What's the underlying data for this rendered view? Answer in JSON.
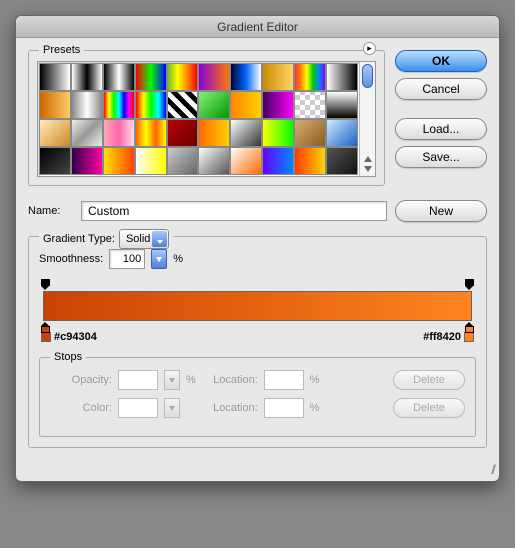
{
  "title": "Gradient Editor",
  "buttons": {
    "ok": "OK",
    "cancel": "Cancel",
    "load": "Load...",
    "save": "Save...",
    "new": "New",
    "delete": "Delete"
  },
  "presets": {
    "legend": "Presets",
    "swatches": [
      "linear-gradient(90deg,#000,#fff)",
      "linear-gradient(90deg,#fff,#000,#fff)",
      "linear-gradient(90deg,#000,#fff,#000)",
      "linear-gradient(90deg,#ff0000,#00ff00,#0000ff)",
      "linear-gradient(90deg,#7b2,#ff0,#f80,#f00)",
      "linear-gradient(90deg,#8800dd,#ff7700)",
      "linear-gradient(90deg,#003,#06f,#fff)",
      "linear-gradient(90deg,#c80,#ffd566)",
      "linear-gradient(90deg,#f33,#f80,#ff0,#0c0,#08f,#80f)",
      "linear-gradient(90deg,rgba(0,0,0,0),#000)",
      "linear-gradient(90deg,#cc6600,#ffcc66)",
      "linear-gradient(90deg,#888,#fff,#888)",
      "linear-gradient(90deg,#f00,#ff0,#0f0,#0ff,#00f,#f0f,#f00)",
      "linear-gradient(90deg,#f00,#ff0,#0f0,#0ff,#00f)",
      "repeating-linear-gradient(45deg,#000 0 5px,#fff 5px 10px)",
      "linear-gradient(135deg,#8e7,#090)",
      "linear-gradient(90deg,#ff8400,#ffd000)",
      "linear-gradient(90deg,#400060,#ff00ff)",
      "repeating-conic-gradient(#ccc 0 25%,#fff 0 50%) 0/10px 10px",
      "linear-gradient(180deg,#fff,#000)",
      "linear-gradient(135deg,#ffeec0,#cc8822)",
      "linear-gradient(135deg,#eee,#999,#eee)",
      "linear-gradient(90deg,#fab,#f6a,#fde)",
      "linear-gradient(90deg,#f60,#ff0,#f60,#ff0)",
      "linear-gradient(135deg,#b00,#600)",
      "linear-gradient(90deg,#ff6a00,#ffd000)",
      "linear-gradient(135deg,#fff,#333)",
      "linear-gradient(90deg,#ff0,#0f0)",
      "linear-gradient(135deg,#d8b070,#8a5a20)",
      "linear-gradient(135deg,#cfeaff,#1a62c8)",
      "linear-gradient(135deg,#000,#444)",
      "linear-gradient(90deg,#330044,#ff00aa)",
      "linear-gradient(90deg,#ffe000,#ff4400)",
      "linear-gradient(90deg,#fff,#ff0)",
      "linear-gradient(135deg,#ccc,#666)",
      "linear-gradient(135deg,#fff,#555)",
      "linear-gradient(135deg,#fff,#ff6a00)",
      "linear-gradient(90deg,#60f,#08f)",
      "linear-gradient(90deg,#ff3a00,#ffd400)",
      "linear-gradient(135deg,#555,#111)"
    ]
  },
  "name": {
    "label": "Name:",
    "value": "Custom"
  },
  "gradientType": {
    "label": "Gradient Type:",
    "value": "Solid"
  },
  "smoothness": {
    "label": "Smoothness:",
    "value": "100",
    "suffix": "%"
  },
  "gradient": {
    "stopLeft": {
      "hex": "#c94304",
      "color": "#c94304"
    },
    "stopRight": {
      "hex": "#ff8420",
      "color": "#ff8420"
    }
  },
  "stops": {
    "legend": "Stops",
    "opacityLabel": "Opacity:",
    "colorLabel": "Color:",
    "locationLabel": "Location:",
    "percent": "%"
  }
}
